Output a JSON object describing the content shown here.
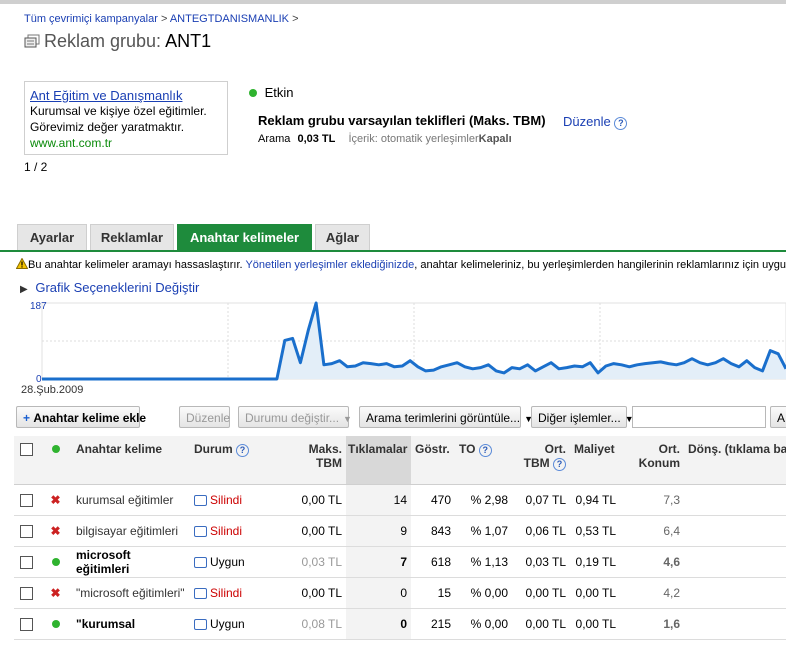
{
  "breadcrumb": {
    "campaigns": "Tüm çevrimiçi kampanyalar",
    "sep": ">",
    "account": "ANTEGTDANISMANLIK",
    "sep2": ">"
  },
  "page": {
    "title_prefix": "Reklam grubu:",
    "title_name": "ANT1"
  },
  "ad_preview": {
    "headline": "Ant Eğitim ve Danışmanlık",
    "line1": "Kurumsal ve kişiye özel eğitimler.",
    "line2": "Görevimiz değer yaratmaktır.",
    "url": "www.ant.com.tr",
    "counter": "1 / 2"
  },
  "status": {
    "label": "Etkin",
    "color": "#2fb32f"
  },
  "bids": {
    "title": "Reklam grubu varsayılan teklifleri (Maks. TBM)",
    "edit": "Düzenle",
    "search_label": "Arama",
    "search_value": "0,03 TL",
    "content_label": "İçerik: otomatik yerleşimler",
    "content_value": "Kapalı"
  },
  "tabs": [
    {
      "label": "Ayarlar"
    },
    {
      "label": "Reklamlar"
    },
    {
      "label": "Anahtar kelimeler",
      "active": true
    },
    {
      "label": "Ağlar"
    }
  ],
  "warning": {
    "text_before": "Bu anahtar kelimeler aramayı hassaslaştırır.",
    "link": "Yönetilen yerleşimler eklediğinizde",
    "text_after": ", anahtar kelimeleriniz, bu yerleşimlerden hangilerinin reklamlarınız için uygun eş"
  },
  "chart_toggle": "Grafik Seçeneklerini Değiştir",
  "chart_data": {
    "type": "area",
    "y_axis_max_label": "187",
    "y_axis_min_label": "0",
    "x_start_label": "28.Şub.2009",
    "ylim": [
      0,
      187
    ],
    "color": "#1a6fcc",
    "values": [
      0,
      0,
      0,
      0,
      0,
      0,
      0,
      0,
      0,
      0,
      0,
      0,
      0,
      0,
      0,
      0,
      0,
      0,
      0,
      0,
      0,
      0,
      0,
      0,
      0,
      0,
      0,
      0,
      0,
      0,
      0,
      95,
      100,
      40,
      120,
      187,
      35,
      38,
      45,
      30,
      32,
      40,
      38,
      35,
      38,
      30,
      32,
      45,
      30,
      20,
      22,
      30,
      35,
      40,
      30,
      25,
      28,
      35,
      20,
      15,
      28,
      25,
      35,
      20,
      30,
      40,
      25,
      28,
      32,
      30,
      40,
      15,
      32,
      38,
      35,
      30,
      35,
      38,
      40,
      42,
      38,
      35,
      40,
      50,
      40,
      35,
      40,
      50,
      38,
      30,
      45,
      28,
      20,
      70,
      62,
      25
    ]
  },
  "toolbar": {
    "add": "Anahtar kelime ekle",
    "edit": "Düzenle",
    "status": "Durumu değiştir...",
    "search_terms": "Arama terimlerini görüntüle...",
    "other": "Diğer işlemler...",
    "apply": "A"
  },
  "table": {
    "headers": {
      "keyword": "Anahtar kelime",
      "status": "Durum",
      "max_cpc_1": "Maks.",
      "max_cpc_2": "TBM",
      "clicks": "Tıklamalar",
      "impr": "Göstr.",
      "ctr": "TO",
      "avg_cpc_1": "Ort.",
      "avg_cpc_2": "TBM",
      "cost": "Maliyet",
      "avg_pos_1": "Ort.",
      "avg_pos_2": "Konum",
      "conv": "Dönş. (tıklama başı"
    },
    "rows": [
      {
        "icon": "x",
        "keyword": "kurumsal eğitimler",
        "status": "Silindi",
        "max_cpc": "0,00 TL",
        "clicks": "14",
        "impr": "470",
        "ctr": "% 2,98",
        "avg_cpc": "0,07 TL",
        "cost": "0,94 TL",
        "pos": "7,3"
      },
      {
        "icon": "x",
        "keyword": "bilgisayar eğitimleri",
        "status": "Silindi",
        "max_cpc": "0,00 TL",
        "clicks": "9",
        "impr": "843",
        "ctr": "% 1,07",
        "avg_cpc": "0,06 TL",
        "cost": "0,53 TL",
        "pos": "6,4"
      },
      {
        "icon": "dot",
        "keyword": "microsoft eğitimleri",
        "status": "Uygun",
        "max_cpc": "0,03 TL",
        "clicks": "7",
        "impr": "618",
        "ctr": "% 1,13",
        "avg_cpc": "0,03 TL",
        "cost": "0,19 TL",
        "pos": "4,6"
      },
      {
        "icon": "x",
        "keyword": "\"microsoft eğitimleri\"",
        "status": "Silindi",
        "max_cpc": "0,00 TL",
        "clicks": "0",
        "impr": "15",
        "ctr": "% 0,00",
        "avg_cpc": "0,00 TL",
        "cost": "0,00 TL",
        "pos": "4,2"
      },
      {
        "icon": "dot",
        "keyword": "\"kurumsal",
        "status": "Uygun",
        "max_cpc": "0,08 TL",
        "clicks": "0",
        "impr": "215",
        "ctr": "% 0,00",
        "avg_cpc": "0,00 TL",
        "cost": "0,00 TL",
        "pos": "1,6"
      }
    ]
  }
}
